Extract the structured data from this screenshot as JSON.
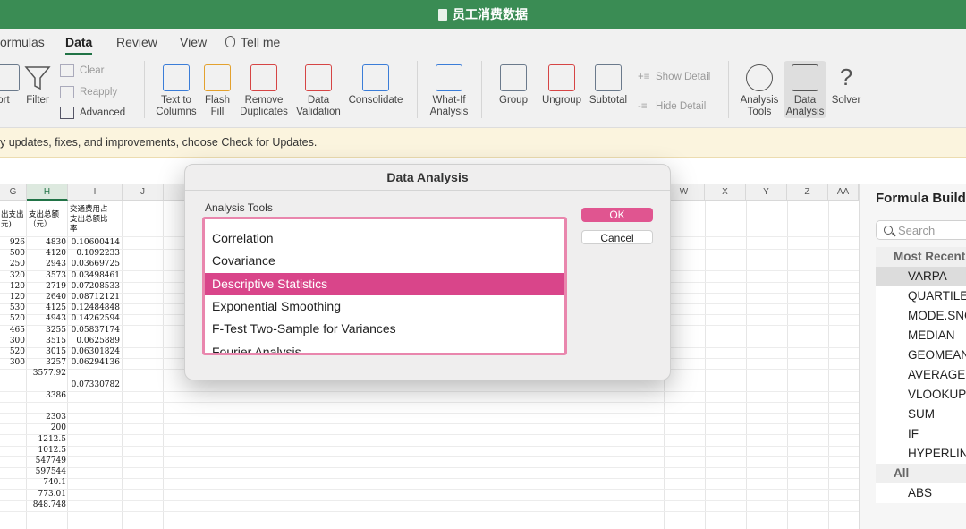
{
  "window": {
    "title": "员工消费数据"
  },
  "tabs": [
    "ormulas",
    "Data",
    "Review",
    "View",
    "Tell me"
  ],
  "ribbon": {
    "sort_label": "ort",
    "filter_label": "Filter",
    "clear_label": "Clear",
    "reapply_label": "Reapply",
    "advanced_label": "Advanced",
    "text_to_columns": [
      "Text to",
      "Columns"
    ],
    "flash_fill": [
      "Flash",
      "Fill"
    ],
    "remove_duplicates": [
      "Remove",
      "Duplicates"
    ],
    "data_validation": [
      "Data",
      "Validation"
    ],
    "consolidate": "Consolidate",
    "what_if": [
      "What-If",
      "Analysis"
    ],
    "group": "Group",
    "ungroup": "Ungroup",
    "subtotal": "Subtotal",
    "show_detail": "Show Detail",
    "hide_detail": "Hide Detail",
    "analysis_tools": [
      "Analysis",
      "Tools"
    ],
    "data_analysis": [
      "Data",
      "Analysis"
    ],
    "solver": "Solver"
  },
  "notice": {
    "text": "y updates, fixes, and improvements, choose Check for Updates."
  },
  "sheet": {
    "columns_left": [
      "G",
      "H",
      "I",
      "J"
    ],
    "columns_right": [
      "W",
      "X",
      "Y",
      "Z",
      "AA"
    ],
    "header_g": [
      "出支出",
      "元)"
    ],
    "header_h": [
      "支出总额",
      "（元）"
    ],
    "header_i": [
      "交通费用占",
      "支出总额比",
      "率"
    ],
    "rows": [
      {
        "g": "926",
        "h": "4830",
        "i": "0.10600414"
      },
      {
        "g": "500",
        "h": "4120",
        "i": "0.1092233"
      },
      {
        "g": "250",
        "h": "2943",
        "i": "0.03669725"
      },
      {
        "g": "320",
        "h": "3573",
        "i": "0.03498461"
      },
      {
        "g": "120",
        "h": "2719",
        "i": "0.07208533"
      },
      {
        "g": "120",
        "h": "2640",
        "i": "0.08712121"
      },
      {
        "g": "530",
        "h": "4125",
        "i": "0.12484848"
      },
      {
        "g": "520",
        "h": "4943",
        "i": "0.14262594"
      },
      {
        "g": "465",
        "h": "3255",
        "i": "0.05837174"
      },
      {
        "g": "300",
        "h": "3515",
        "i": "0.0625889"
      },
      {
        "g": "520",
        "h": "3015",
        "i": "0.06301824"
      },
      {
        "g": "300",
        "h": "3257",
        "i": "0.06294136"
      },
      {
        "g": "",
        "h": "3577.92",
        "i": ""
      },
      {
        "g": "",
        "h": "",
        "i": "0.07330782"
      },
      {
        "g": "",
        "h": "3386",
        "i": ""
      },
      {
        "g": "",
        "h": "",
        "i": ""
      },
      {
        "g": "",
        "h": "2303",
        "i": ""
      },
      {
        "g": "",
        "h": "200",
        "i": ""
      },
      {
        "g": "",
        "h": "1212.5",
        "i": ""
      },
      {
        "g": "",
        "h": "1012.5",
        "i": ""
      },
      {
        "g": "",
        "h": "547749",
        "i": ""
      },
      {
        "g": "",
        "h": "597544",
        "i": ""
      },
      {
        "g": "",
        "h": "740.1",
        "i": ""
      },
      {
        "g": "",
        "h": "773.01",
        "i": ""
      },
      {
        "g": "",
        "h": "848.748",
        "i": ""
      }
    ]
  },
  "dialog": {
    "title": "Data Analysis",
    "label": "Analysis Tools",
    "items": [
      "Correlation",
      "Covariance",
      "Descriptive Statistics",
      "Exponential Smoothing",
      "F-Test Two-Sample for Variances",
      "Fourier Analysis"
    ],
    "selected": "Descriptive Statistics",
    "ok": "OK",
    "cancel": "Cancel"
  },
  "formula_builder": {
    "title": "Formula Build",
    "search_placeholder": "Search",
    "most_recent_label": "Most Recent",
    "recent": [
      "VARPA",
      "QUARTILE",
      "MODE.SNG",
      "MEDIAN",
      "GEOMEAN",
      "AVERAGE",
      "VLOOKUP",
      "SUM",
      "IF",
      "HYPERLIN"
    ],
    "all_label": "All",
    "all": [
      "ABS"
    ]
  },
  "colors": {
    "title_bar": "#3a8c54",
    "accent": "#217346",
    "selection": "#d9458a",
    "ok_button": "#e05590",
    "notice": "#fbf4de"
  }
}
